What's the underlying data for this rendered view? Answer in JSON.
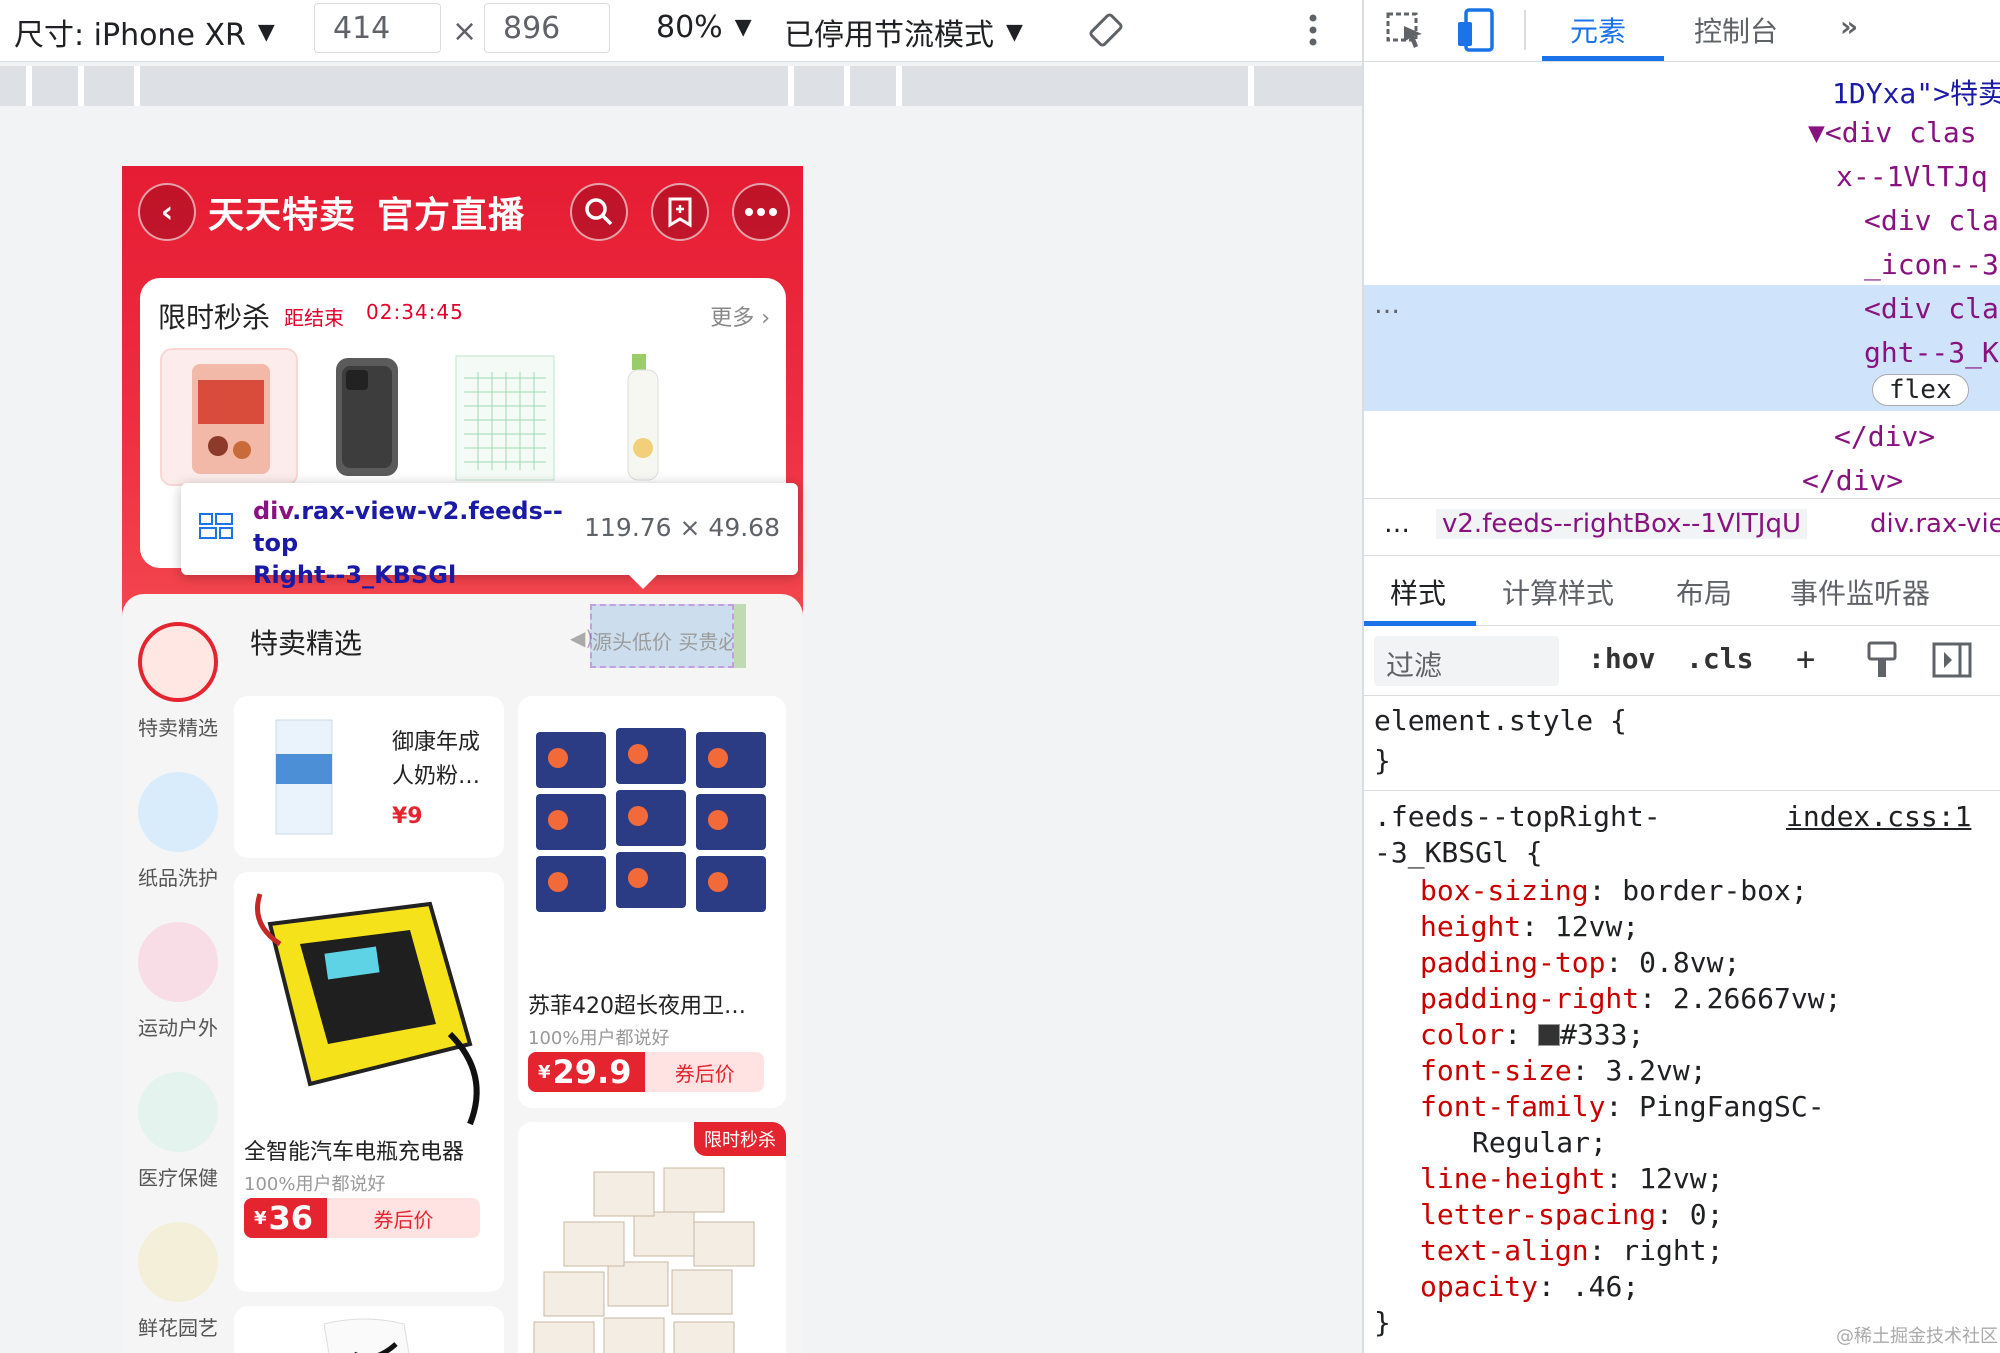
{
  "toolbar": {
    "device_label": "尺寸: iPhone XR",
    "width_value": "414",
    "times_symbol": "×",
    "height_value": "896",
    "zoom": "80%",
    "throttle": "已停用节流模式"
  },
  "phone": {
    "header": {
      "brand_left": "天天特卖",
      "brand_right": "官方直播"
    },
    "flash_sale": {
      "title": "限时秒杀",
      "countdown_label": "距结束",
      "countdown": "02:34:45",
      "more": "更多"
    },
    "tooltip": {
      "tag": "div",
      "classes": ".rax-view-v2.feeds--top",
      "classes_line2": "Right--3_KBSGl",
      "dimensions": "119.76 × 49.68"
    },
    "feed": {
      "section_title": "特卖精选",
      "top_right_text": "源头低价 买贵必赔",
      "categories": [
        {
          "label": "特卖精选"
        },
        {
          "label": "纸品洗护"
        },
        {
          "label": "运动户外"
        },
        {
          "label": "医疗保健"
        },
        {
          "label": "鲜花园艺"
        }
      ],
      "cards": [
        {
          "title_line1": "御康年成",
          "title_line2": "人奶粉…",
          "price": "¥9"
        },
        {
          "title": "苏菲420超长夜用卫…",
          "sub": "100%用户都说好",
          "currency": "¥",
          "price": "29.9",
          "price_label": "券后价"
        },
        {
          "title": "全智能汽车电瓶充电器",
          "sub": "100%用户都说好",
          "currency": "¥",
          "price": "36",
          "price_label": "券后价"
        },
        {
          "badge": "限时秒杀"
        }
      ]
    }
  },
  "devtools": {
    "tabs": [
      "元素",
      "控制台"
    ],
    "more_tabs": "»",
    "dom_lines": [
      {
        "text": "1DYxa\">特卖"
      },
      {
        "text": "▼<div clas"
      },
      {
        "text": "x--1VlTJq"
      },
      {
        "text": "<div cla"
      },
      {
        "text": "_icon--3"
      },
      {
        "text": "<div cla"
      },
      {
        "text": "ght--3_K"
      },
      {
        "text": "flex"
      },
      {
        "text": "</div>"
      },
      {
        "text": "</div>"
      }
    ],
    "dots": "…",
    "breadcrumb_ellipsis": "…",
    "breadcrumb_1": "v2.feeds--rightBox--1VlTJqU",
    "breadcrumb_2": "div.rax-vie",
    "style_tabs": [
      "样式",
      "计算样式",
      "布局",
      "事件监听器"
    ],
    "filter_placeholder": "过滤",
    "hov": ":hov",
    "cls": ".cls",
    "plus": "+",
    "element_style": "element.style {",
    "close_brace": "}",
    "rule_selector_1": ".feeds--topRight-",
    "rule_selector_2": "-3_KBSGl {",
    "rule_source": "index.css:1",
    "declarations": [
      {
        "prop": "box-sizing",
        "value": "border-box;"
      },
      {
        "prop": "height",
        "value": "12vw;"
      },
      {
        "prop": "padding-top",
        "value": "0.8vw;"
      },
      {
        "prop": "padding-right",
        "value": "2.26667vw;"
      },
      {
        "prop": "color",
        "value": "#333;"
      },
      {
        "prop": "font-size",
        "value": "3.2vw;"
      },
      {
        "prop": "font-family",
        "value": "PingFangSC-"
      },
      {
        "prop": "",
        "value": "Regular;"
      },
      {
        "prop": "line-height",
        "value": "12vw;"
      },
      {
        "prop": "letter-spacing",
        "value": "0;"
      },
      {
        "prop": "text-align",
        "value": "right;"
      },
      {
        "prop": "opacity",
        "value": ".46;"
      }
    ],
    "rule_close": "}"
  },
  "watermark": "@稀土掘金技术社区"
}
